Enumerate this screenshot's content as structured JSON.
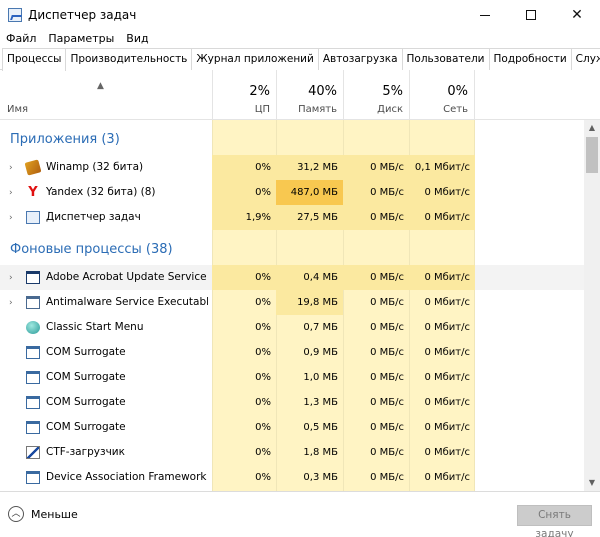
{
  "window": {
    "title": "Диспетчер задач"
  },
  "menu": [
    "Файл",
    "Параметры",
    "Вид"
  ],
  "tabs": [
    {
      "label": "Процессы",
      "active": true
    },
    {
      "label": "Производительность"
    },
    {
      "label": "Журнал приложений"
    },
    {
      "label": "Автозагрузка"
    },
    {
      "label": "Пользователи"
    },
    {
      "label": "Подробности"
    },
    {
      "label": "Службы"
    }
  ],
  "header": {
    "name": "Имя",
    "cpu": {
      "pct": "2%",
      "label": "ЦП"
    },
    "mem": {
      "pct": "40%",
      "label": "Память"
    },
    "disk": {
      "pct": "5%",
      "label": "Диск"
    },
    "net": {
      "pct": "0%",
      "label": "Сеть"
    }
  },
  "groups": {
    "apps": "Приложения (3)",
    "background": "Фоновые процессы (38)"
  },
  "apps": [
    {
      "name": "Winamp (32 бита)",
      "icon": "winamp-icon",
      "cpu": "0%",
      "mem": "31,2 МБ",
      "disk": "0 МБ/с",
      "net": "0,1 Мбит/с"
    },
    {
      "name": "Yandex (32 бита) (8)",
      "icon": "yandex-icon",
      "cpu": "0%",
      "mem": "487,0 МБ",
      "disk": "0 МБ/с",
      "net": "0 Мбит/с"
    },
    {
      "name": "Диспетчер задач",
      "icon": "task-manager-icon",
      "cpu": "1,9%",
      "mem": "27,5 МБ",
      "disk": "0 МБ/с",
      "net": "0 Мбит/с"
    }
  ],
  "background": [
    {
      "name": "Adobe Acrobat Update Service (…",
      "icon": "window-icon",
      "expand": true,
      "cpu": "0%",
      "mem": "0,4 МБ",
      "disk": "0 МБ/с",
      "net": "0 Мбит/с"
    },
    {
      "name": "Antimalware Service Executable",
      "icon": "shield-window-icon",
      "expand": true,
      "cpu": "0%",
      "mem": "19,8 МБ",
      "disk": "0 МБ/с",
      "net": "0 Мбит/с"
    },
    {
      "name": "Classic Start Menu",
      "icon": "orb-icon",
      "cpu": "0%",
      "mem": "0,7 МБ",
      "disk": "0 МБ/с",
      "net": "0 Мбит/с"
    },
    {
      "name": "COM Surrogate",
      "icon": "com-icon",
      "cpu": "0%",
      "mem": "0,9 МБ",
      "disk": "0 МБ/с",
      "net": "0 Мбит/с"
    },
    {
      "name": "COM Surrogate",
      "icon": "com-icon",
      "cpu": "0%",
      "mem": "1,0 МБ",
      "disk": "0 МБ/с",
      "net": "0 Мбит/с"
    },
    {
      "name": "COM Surrogate",
      "icon": "com-icon",
      "cpu": "0%",
      "mem": "1,3 МБ",
      "disk": "0 МБ/с",
      "net": "0 Мбит/с"
    },
    {
      "name": "COM Surrogate",
      "icon": "com-icon",
      "cpu": "0%",
      "mem": "0,5 МБ",
      "disk": "0 МБ/с",
      "net": "0 Мбит/с"
    },
    {
      "name": "CTF-загрузчик",
      "icon": "ctf-icon",
      "cpu": "0%",
      "mem": "1,8 МБ",
      "disk": "0 МБ/с",
      "net": "0 Мбит/с"
    },
    {
      "name": "Device Association Framework …",
      "icon": "device-icon",
      "cpu": "0%",
      "mem": "0,3 МБ",
      "disk": "0 МБ/с",
      "net": "0 Мбит/с"
    }
  ],
  "footer": {
    "less": "Меньше",
    "end_task": "Снять задачу"
  },
  "colors": {
    "group_title": "#2b6cb5",
    "heat_light": "#fff4c4",
    "heat_mid": "#fbe9a0",
    "heat_high": "#f8c850"
  }
}
